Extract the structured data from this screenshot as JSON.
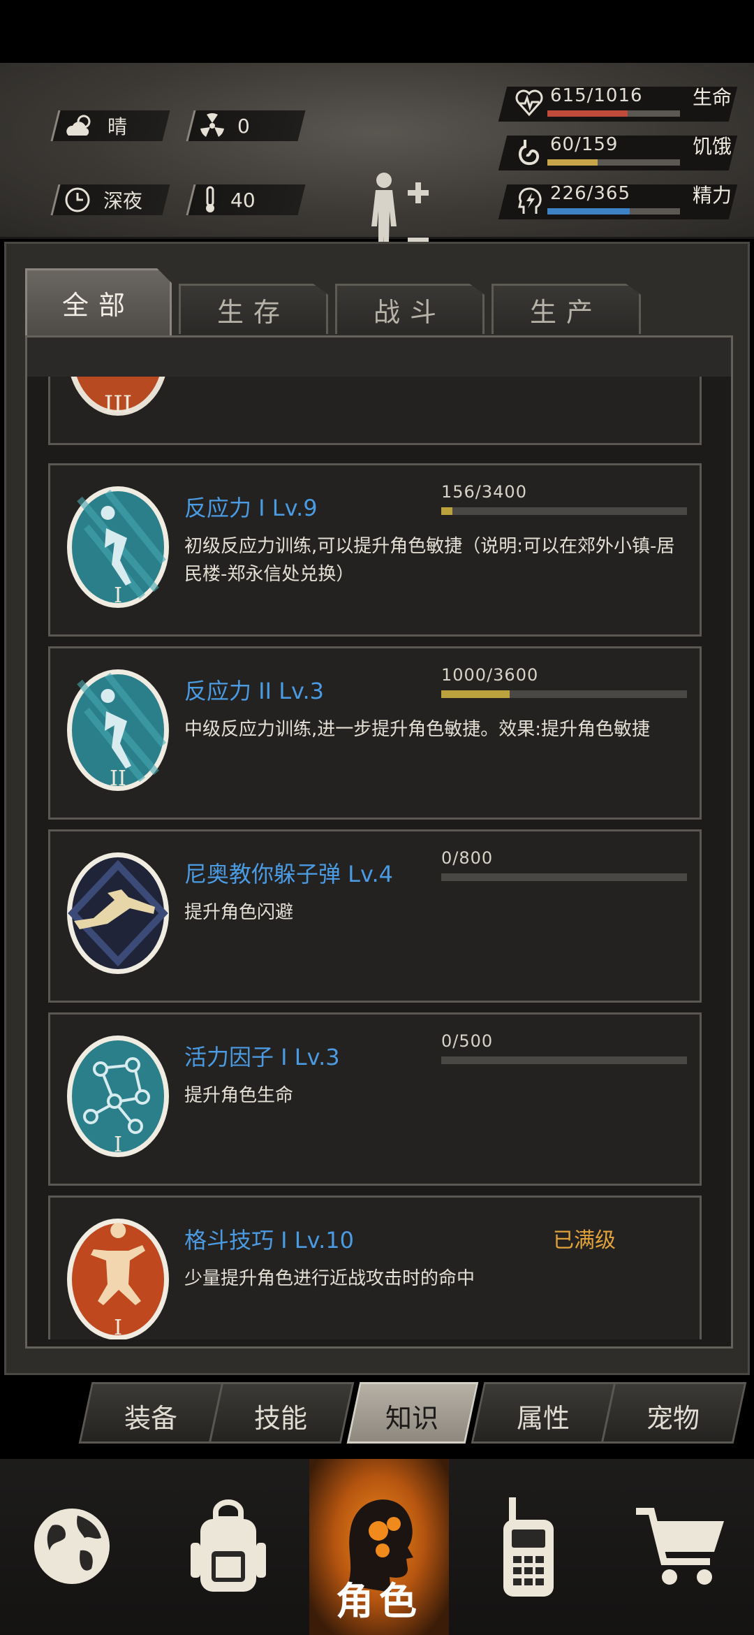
{
  "hud": {
    "weather": {
      "icon": "cloud-sun-icon",
      "label": "晴"
    },
    "radiation": {
      "icon": "radiation-icon",
      "value": "0"
    },
    "time": {
      "icon": "clock-icon",
      "label": "深夜"
    },
    "temperature": {
      "icon": "thermometer-icon",
      "value": "40"
    },
    "stats": [
      {
        "name": "health",
        "icon": "heart-pulse-icon",
        "value": "615/1016",
        "label": "生命",
        "fraction": 0.605,
        "color": "#c24a3a"
      },
      {
        "name": "hunger",
        "icon": "stomach-icon",
        "value": "60/159",
        "label": "饥饿",
        "fraction": 0.377,
        "color": "#c8a44a"
      },
      {
        "name": "energy",
        "icon": "lightning-head-icon",
        "value": "226/365",
        "label": "精力",
        "fraction": 0.619,
        "color": "#3d82c4"
      }
    ]
  },
  "tabs": [
    {
      "label": "全部",
      "active": true
    },
    {
      "label": "生存",
      "active": false
    },
    {
      "label": "战斗",
      "active": false
    },
    {
      "label": "生产",
      "active": false
    }
  ],
  "skills": [
    {
      "title": "反应力 I Lv.9",
      "progress": "156/3400",
      "fraction": 0.046,
      "desc": "初级反应力训练,可以提升角色敏捷（说明:可以在郊外小镇-居民楼-郑永信处兑换）",
      "icon": "reflex-1-icon"
    },
    {
      "title": "反应力 II Lv.3",
      "progress": "1000/3600",
      "fraction": 0.278,
      "desc": "中级反应力训练,进一步提升角色敏捷。效果:提升角色敏捷",
      "icon": "reflex-2-icon"
    },
    {
      "title": "尼奥教你躲子弹 Lv.4",
      "progress": "0/800",
      "fraction": 0,
      "desc": "提升角色闪避",
      "icon": "dodge-icon"
    },
    {
      "title": "活力因子 I Lv.3",
      "progress": "0/500",
      "fraction": 0,
      "desc": "提升角色生命",
      "icon": "molecule-icon"
    },
    {
      "title": "格斗技巧 I Lv.10",
      "max": "已满级",
      "desc": "少量提升角色进行近战攻击时的命中",
      "icon": "martial-arts-icon"
    }
  ],
  "sub_tabs": [
    {
      "label": "装备",
      "active": false
    },
    {
      "label": "技能",
      "active": false
    },
    {
      "label": "知识",
      "active": true
    },
    {
      "label": "属性",
      "active": false
    },
    {
      "label": "宠物",
      "active": false
    }
  ],
  "nav": {
    "items": [
      "globe-icon",
      "backpack-icon",
      "character-head-icon",
      "walkie-talkie-icon",
      "shopping-cart-icon"
    ],
    "active_label": "角色"
  }
}
